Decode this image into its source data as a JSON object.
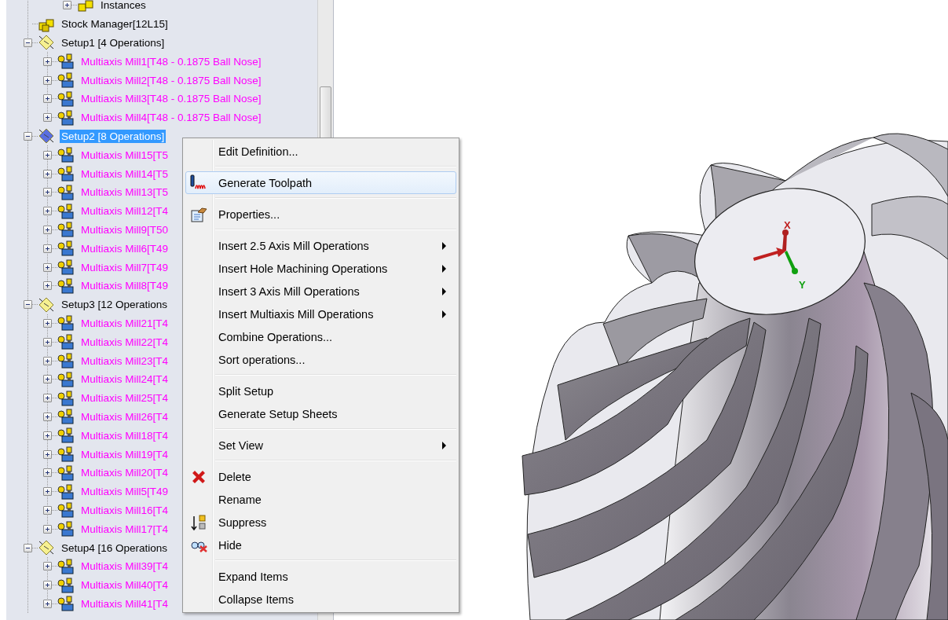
{
  "tree": {
    "cut_off_items": [
      {
        "label": "Instances",
        "kind": "instances",
        "expanded": false,
        "selected": false
      }
    ],
    "items": [
      {
        "label": "Stock Manager[12L15]",
        "kind": "stock",
        "selected": false
      },
      {
        "label": "Setup1 [4 Operations]",
        "kind": "setup",
        "expanded": true,
        "selected": false,
        "children": [
          {
            "label": "Multiaxis Mill1[T48 - 0.1875 Ball Nose]",
            "kind": "operation",
            "expanded": false,
            "selected": false
          },
          {
            "label": "Multiaxis Mill2[T48 - 0.1875 Ball Nose]",
            "kind": "operation",
            "expanded": false,
            "selected": false
          },
          {
            "label": "Multiaxis Mill3[T48 - 0.1875 Ball Nose]",
            "kind": "operation",
            "expanded": false,
            "selected": false
          },
          {
            "label": "Multiaxis Mill4[T48 - 0.1875 Ball Nose]",
            "kind": "operation",
            "expanded": false,
            "selected": false
          }
        ]
      },
      {
        "label": "Setup2 [8 Operations]",
        "kind": "setup",
        "expanded": true,
        "selected": true,
        "children": [
          {
            "label": "Multiaxis Mill15[T5",
            "kind": "operation",
            "expanded": false,
            "selected": false
          },
          {
            "label": "Multiaxis Mill14[T5",
            "kind": "operation",
            "expanded": false,
            "selected": false
          },
          {
            "label": "Multiaxis Mill13[T5",
            "kind": "operation",
            "expanded": false,
            "selected": false
          },
          {
            "label": "Multiaxis Mill12[T4",
            "kind": "operation",
            "expanded": false,
            "selected": false
          },
          {
            "label": "Multiaxis Mill9[T50",
            "kind": "operation",
            "expanded": false,
            "selected": false
          },
          {
            "label": "Multiaxis Mill6[T49",
            "kind": "operation",
            "expanded": false,
            "selected": false
          },
          {
            "label": "Multiaxis Mill7[T49",
            "kind": "operation",
            "expanded": false,
            "selected": false
          },
          {
            "label": "Multiaxis Mill8[T49",
            "kind": "operation",
            "expanded": false,
            "selected": false
          }
        ]
      },
      {
        "label": "Setup3 [12 Operations",
        "kind": "setup",
        "expanded": true,
        "selected": false,
        "children": [
          {
            "label": "Multiaxis Mill21[T4",
            "kind": "operation",
            "expanded": false,
            "selected": false
          },
          {
            "label": "Multiaxis Mill22[T4",
            "kind": "operation",
            "expanded": false,
            "selected": false
          },
          {
            "label": "Multiaxis Mill23[T4",
            "kind": "operation",
            "expanded": false,
            "selected": false
          },
          {
            "label": "Multiaxis Mill24[T4",
            "kind": "operation",
            "expanded": false,
            "selected": false
          },
          {
            "label": "Multiaxis Mill25[T4",
            "kind": "operation",
            "expanded": false,
            "selected": false
          },
          {
            "label": "Multiaxis Mill26[T4",
            "kind": "operation",
            "expanded": false,
            "selected": false
          },
          {
            "label": "Multiaxis Mill18[T4",
            "kind": "operation",
            "expanded": false,
            "selected": false
          },
          {
            "label": "Multiaxis Mill19[T4",
            "kind": "operation",
            "expanded": false,
            "selected": false
          },
          {
            "label": "Multiaxis Mill20[T4",
            "kind": "operation",
            "expanded": false,
            "selected": false
          },
          {
            "label": "Multiaxis Mill5[T49",
            "kind": "operation",
            "expanded": false,
            "selected": false
          },
          {
            "label": "Multiaxis Mill16[T4",
            "kind": "operation",
            "expanded": false,
            "selected": false
          },
          {
            "label": "Multiaxis Mill17[T4",
            "kind": "operation",
            "expanded": false,
            "selected": false
          }
        ]
      },
      {
        "label": "Setup4 [16 Operations",
        "kind": "setup",
        "expanded": true,
        "selected": false,
        "children": [
          {
            "label": "Multiaxis Mill39[T4",
            "kind": "operation",
            "expanded": false,
            "selected": false
          },
          {
            "label": "Multiaxis Mill40[T4",
            "kind": "operation",
            "expanded": false,
            "selected": false
          },
          {
            "label": "Multiaxis Mill41[T4",
            "kind": "operation",
            "expanded": false,
            "selected": false
          }
        ]
      }
    ]
  },
  "context_menu": {
    "groups": [
      [
        {
          "label": "Edit Definition...",
          "highlighted": false,
          "submenu": false
        }
      ],
      [
        {
          "label": "Generate Toolpath",
          "highlighted": true,
          "submenu": false,
          "kind": "toolpath"
        }
      ],
      [
        {
          "label": "Properties...",
          "highlighted": false,
          "submenu": false,
          "kind": "properties"
        }
      ],
      [
        {
          "label": "Insert 2.5 Axis Mill Operations",
          "highlighted": false,
          "submenu": true
        },
        {
          "label": "Insert Hole Machining Operations",
          "highlighted": false,
          "submenu": true
        },
        {
          "label": "Insert 3 Axis Mill Operations",
          "highlighted": false,
          "submenu": true
        },
        {
          "label": "Insert Multiaxis Mill Operations",
          "highlighted": false,
          "submenu": true
        },
        {
          "label": "Combine Operations...",
          "highlighted": false,
          "submenu": false
        },
        {
          "label": "Sort operations...",
          "highlighted": false,
          "submenu": false
        }
      ],
      [
        {
          "label": "Split Setup",
          "highlighted": false,
          "submenu": false
        },
        {
          "label": "Generate Setup Sheets",
          "highlighted": false,
          "submenu": false
        }
      ],
      [
        {
          "label": "Set View",
          "highlighted": false,
          "submenu": true
        }
      ],
      [
        {
          "label": "Delete",
          "highlighted": false,
          "submenu": false,
          "kind": "delete"
        },
        {
          "label": "Rename",
          "highlighted": false,
          "submenu": false
        },
        {
          "label": "Suppress",
          "highlighted": false,
          "submenu": false,
          "kind": "suppress"
        },
        {
          "label": "Hide",
          "highlighted": false,
          "submenu": false,
          "kind": "hide"
        }
      ],
      [
        {
          "label": "Expand Items",
          "highlighted": false,
          "submenu": false
        },
        {
          "label": "Collapse Items",
          "highlighted": false,
          "submenu": false
        }
      ]
    ]
  },
  "viewport": {
    "triad": {
      "x_label": "X",
      "y_label": "Y"
    }
  }
}
